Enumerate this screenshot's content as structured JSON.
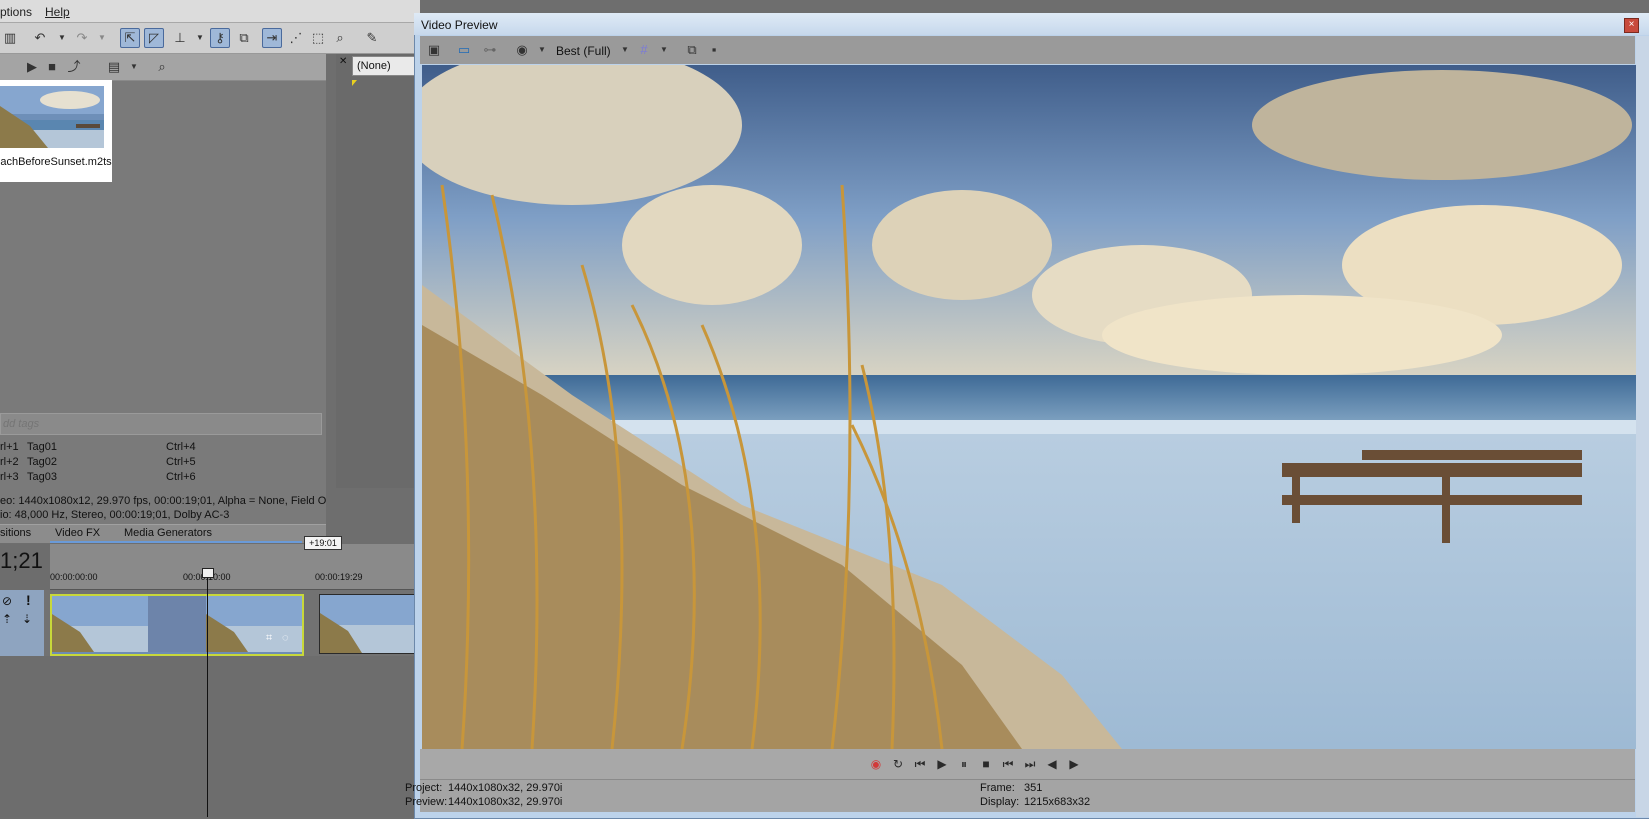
{
  "menu": {
    "options_label": "ptions",
    "help_label": "Help"
  },
  "explorer": {
    "media_file": "achBeforeSunset.m2ts",
    "tags_placeholder": "dd tags",
    "tags": [
      {
        "key": "rl+1",
        "name": "Tag01",
        "shortcut": "Ctrl+4"
      },
      {
        "key": "rl+2",
        "name": "Tag02",
        "shortcut": "Ctrl+5"
      },
      {
        "key": "rl+3",
        "name": "Tag03",
        "shortcut": "Ctrl+6"
      }
    ],
    "video_info": "eo: 1440x1080x12, 29.970 fps, 00:00:19;01, Alpha = None, Field O",
    "audio_info": "io: 48,000 Hz, Stereo, 00:00:19;01, Dolby AC-3"
  },
  "tabs": [
    "sitions",
    "Video FX",
    "Media Generators"
  ],
  "trimmer": {
    "selection": "(None)"
  },
  "timeline": {
    "time_display": "1;21",
    "duration_badge": "+19:01",
    "ruler": [
      "00:00:00:00",
      "00:00:10:00",
      "00:00:19:29"
    ]
  },
  "preview": {
    "title": "Video Preview",
    "quality": "Best (Full)",
    "close_label": "×",
    "status": {
      "project_label": "Project:",
      "project_value": "1440x1080x32, 29.970i",
      "preview_label": "Preview:",
      "preview_value": "1440x1080x32, 29.970i",
      "frame_label": "Frame:",
      "frame_value": "351",
      "display_label": "Display:",
      "display_value": "1215x683x32"
    }
  },
  "colors": {
    "accent": "#4a6a9c",
    "window_border": "#6c88aa",
    "record": "#d23a3a"
  }
}
